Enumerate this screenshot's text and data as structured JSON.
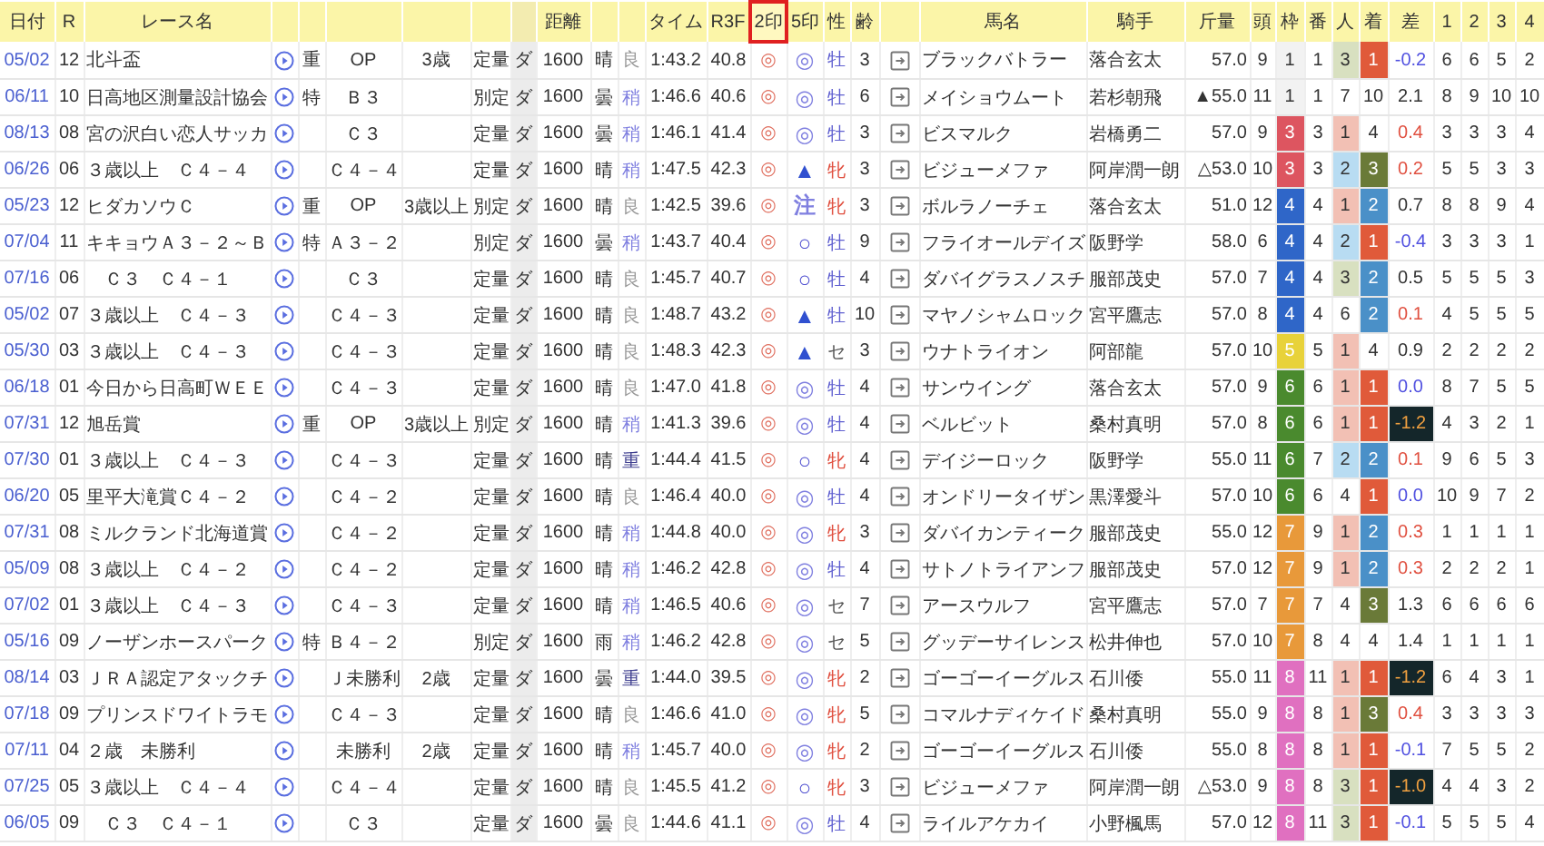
{
  "columns": [
    {
      "label": "日付",
      "selected": false
    },
    {
      "label": "R",
      "selected": false
    },
    {
      "label": "レース名",
      "selected": false
    },
    {
      "selected": false
    },
    {
      "selected": false
    },
    {
      "selected": false
    },
    {
      "selected": false
    },
    {
      "selected": false
    },
    {
      "selected": false
    },
    {
      "label": "距離",
      "selected": false
    },
    {
      "selected": false
    },
    {
      "selected": false
    },
    {
      "label": "タイム",
      "selected": false
    },
    {
      "label": "R3F",
      "selected": false
    },
    {
      "label": "2印",
      "selected": true
    },
    {
      "label": "5印",
      "selected": false
    },
    {
      "label": "性",
      "selected": false
    },
    {
      "label": "齢",
      "selected": false
    },
    {
      "selected": false
    },
    {
      "label": "馬名",
      "selected": false
    },
    {
      "label": "騎手",
      "selected": false
    },
    {
      "label": "斤量",
      "selected": false
    },
    {
      "label": "頭",
      "selected": false
    },
    {
      "label": "枠",
      "selected": false
    },
    {
      "label": "番",
      "selected": false
    },
    {
      "label": "人",
      "selected": false
    },
    {
      "label": "着",
      "selected": false
    },
    {
      "label": "差",
      "selected": false
    },
    {
      "label": "1",
      "selected": false
    },
    {
      "label": "2",
      "selected": false
    },
    {
      "label": "3",
      "selected": false
    },
    {
      "label": "4",
      "selected": false
    }
  ],
  "rows": [
    {
      "date": "05/02",
      "r": "12",
      "name": "北斗盃",
      "grade": "重",
      "class": "OP",
      "age": "3歳",
      "rule": "定量",
      "surface": "ダ",
      "distance": "1600",
      "weather": "晴",
      "going": {
        "text": "良",
        "color": "#999999"
      },
      "time": "1:43.2",
      "r3f": "40.8",
      "mark2": "◎",
      "mark5": {
        "text": "◎",
        "color": "#8080e0"
      },
      "sex": {
        "text": "牡",
        "color": "#6060d0"
      },
      "years": "3",
      "horse": "ブラックバトラー",
      "jockey": "落合玄太",
      "kinryo": "57.0",
      "heads": "9",
      "frame": {
        "text": "1",
        "color": "#f2f2f2",
        "kind": "light"
      },
      "number": "1",
      "pop": {
        "text": "3",
        "color": "#d8e0c0"
      },
      "finish": {
        "text": "1",
        "color": "#e05a3a"
      },
      "diff": {
        "text": "-0.2",
        "kind": "neg"
      },
      "corners": [
        "6",
        "6",
        "5",
        "2"
      ]
    },
    {
      "date": "06/11",
      "r": "10",
      "name": "日高地区測量設計協会",
      "grade": "特",
      "class": "Ｂ３",
      "rule": "別定",
      "surface": "ダ",
      "distance": "1600",
      "weather": "曇",
      "going": {
        "text": "稍",
        "color": "#8080e0"
      },
      "time": "1:46.6",
      "r3f": "40.6",
      "mark2": "◎",
      "mark5": {
        "text": "◎",
        "color": "#8080e0"
      },
      "sex": {
        "text": "牡",
        "color": "#6060d0"
      },
      "years": "6",
      "horse": "メイショウムート",
      "jockey": "若杉朝飛",
      "kinryo": "▲55.0",
      "heads": "11",
      "frame": {
        "text": "1",
        "color": "#f2f2f2",
        "kind": "light"
      },
      "number": "1",
      "pop": {
        "text": "7"
      },
      "finish": {
        "text": "10"
      },
      "diff": {
        "text": "2.1",
        "kind": "plain"
      },
      "corners": [
        "8",
        "9",
        "10",
        "10"
      ]
    },
    {
      "date": "08/13",
      "r": "08",
      "name": "宮の沢白い恋人サッカ",
      "class": "Ｃ３",
      "rule": "定量",
      "surface": "ダ",
      "distance": "1600",
      "weather": "曇",
      "going": {
        "text": "稍",
        "color": "#8080e0"
      },
      "time": "1:46.1",
      "r3f": "41.4",
      "mark2": "◎",
      "mark5": {
        "text": "◎",
        "color": "#8080e0"
      },
      "sex": {
        "text": "牡",
        "color": "#6060d0"
      },
      "years": "3",
      "horse": "ビスマルク",
      "jockey": "岩橋勇二",
      "kinryo": "57.0",
      "heads": "9",
      "frame": {
        "text": "3",
        "color": "#dd5560",
        "kind": "dark"
      },
      "number": "3",
      "pop": {
        "text": "1",
        "color": "#f2c0b4"
      },
      "finish": {
        "text": "4"
      },
      "diff": {
        "text": "0.4",
        "kind": "pos"
      },
      "corners": [
        "3",
        "3",
        "3",
        "4"
      ]
    },
    {
      "date": "06/26",
      "r": "06",
      "name": "３歳以上　Ｃ４－４",
      "class": "Ｃ４－４",
      "rule": "定量",
      "surface": "ダ",
      "distance": "1600",
      "weather": "晴",
      "going": {
        "text": "稍",
        "color": "#8080e0"
      },
      "time": "1:47.5",
      "r3f": "42.3",
      "mark2": "◎",
      "mark5": {
        "text": "▲",
        "color": "#3050d0"
      },
      "sex": {
        "text": "牝",
        "color": "#e05040"
      },
      "years": "3",
      "horse": "ビジューメファ",
      "jockey": "阿岸潤一朗",
      "kinryo": "△53.0",
      "heads": "10",
      "frame": {
        "text": "3",
        "color": "#dd5560",
        "kind": "dark"
      },
      "number": "3",
      "pop": {
        "text": "2",
        "color": "#b8dcf2"
      },
      "finish": {
        "text": "3",
        "color": "#6a7a38"
      },
      "diff": {
        "text": "0.2",
        "kind": "pos"
      },
      "corners": [
        "5",
        "5",
        "3",
        "3"
      ]
    },
    {
      "date": "05/23",
      "r": "12",
      "name": "ヒダカソウＣ",
      "grade": "重",
      "class": "OP",
      "age": "3歳以上",
      "rule": "別定",
      "surface": "ダ",
      "distance": "1600",
      "weather": "晴",
      "going": {
        "text": "良",
        "color": "#999999"
      },
      "time": "1:42.5",
      "r3f": "39.6",
      "mark2": "◎",
      "mark5": {
        "text": "注",
        "color": "#8080e0"
      },
      "sex": {
        "text": "牝",
        "color": "#e05040"
      },
      "years": "3",
      "horse": "ボルラノーチェ",
      "jockey": "落合玄太",
      "kinryo": "51.0",
      "heads": "12",
      "frame": {
        "text": "4",
        "color": "#2f66c8",
        "kind": "dark"
      },
      "number": "4",
      "pop": {
        "text": "1",
        "color": "#f2c0b4"
      },
      "finish": {
        "text": "2",
        "color": "#4a90c8"
      },
      "diff": {
        "text": "0.7",
        "kind": "plain"
      },
      "corners": [
        "8",
        "8",
        "9",
        "4"
      ]
    },
    {
      "date": "07/04",
      "r": "11",
      "name": "キキョウＡ３－２～Ｂ",
      "grade": "特",
      "class": "Ａ３－２",
      "rule": "別定",
      "surface": "ダ",
      "distance": "1600",
      "weather": "曇",
      "going": {
        "text": "稍",
        "color": "#8080e0"
      },
      "time": "1:43.7",
      "r3f": "40.4",
      "mark2": "◎",
      "mark5": {
        "text": "○",
        "color": "#5050d0"
      },
      "sex": {
        "text": "牡",
        "color": "#6060d0"
      },
      "years": "9",
      "horse": "フライオールデイズ",
      "jockey": "阪野学",
      "kinryo": "58.0",
      "heads": "6",
      "frame": {
        "text": "4",
        "color": "#2f66c8",
        "kind": "dark"
      },
      "number": "4",
      "pop": {
        "text": "2",
        "color": "#b8dcf2"
      },
      "finish": {
        "text": "1",
        "color": "#e05a3a"
      },
      "diff": {
        "text": "-0.4",
        "kind": "neg"
      },
      "corners": [
        "3",
        "3",
        "3",
        "1"
      ]
    },
    {
      "date": "07/16",
      "r": "06",
      "name": "　Ｃ３　Ｃ４－１",
      "class": "Ｃ３",
      "rule": "定量",
      "surface": "ダ",
      "distance": "1600",
      "weather": "晴",
      "going": {
        "text": "良",
        "color": "#999999"
      },
      "time": "1:45.7",
      "r3f": "40.7",
      "mark2": "◎",
      "mark5": {
        "text": "○",
        "color": "#5050d0"
      },
      "sex": {
        "text": "牡",
        "color": "#6060d0"
      },
      "years": "4",
      "horse": "ダバイグラスノスチ",
      "jockey": "服部茂史",
      "kinryo": "57.0",
      "heads": "7",
      "frame": {
        "text": "4",
        "color": "#2f66c8",
        "kind": "dark"
      },
      "number": "4",
      "pop": {
        "text": "3",
        "color": "#d8e0c0"
      },
      "finish": {
        "text": "2",
        "color": "#4a90c8"
      },
      "diff": {
        "text": "0.5",
        "kind": "plain"
      },
      "corners": [
        "5",
        "5",
        "5",
        "3"
      ]
    },
    {
      "date": "05/02",
      "r": "07",
      "name": "３歳以上　Ｃ４－３",
      "class": "Ｃ４－３",
      "rule": "定量",
      "surface": "ダ",
      "distance": "1600",
      "weather": "晴",
      "going": {
        "text": "良",
        "color": "#999999"
      },
      "time": "1:48.7",
      "r3f": "43.2",
      "mark2": "◎",
      "mark5": {
        "text": "▲",
        "color": "#3050d0"
      },
      "sex": {
        "text": "牡",
        "color": "#6060d0"
      },
      "years": "10",
      "horse": "マヤノシャムロック",
      "jockey": "宮平鷹志",
      "kinryo": "57.0",
      "heads": "8",
      "frame": {
        "text": "4",
        "color": "#2f66c8",
        "kind": "dark"
      },
      "number": "4",
      "pop": {
        "text": "6"
      },
      "finish": {
        "text": "2",
        "color": "#4a90c8"
      },
      "diff": {
        "text": "0.1",
        "kind": "pos"
      },
      "corners": [
        "4",
        "5",
        "5",
        "5"
      ]
    },
    {
      "date": "05/30",
      "r": "03",
      "name": "３歳以上　Ｃ４－３",
      "class": "Ｃ４－３",
      "rule": "定量",
      "surface": "ダ",
      "distance": "1600",
      "weather": "晴",
      "going": {
        "text": "良",
        "color": "#999999"
      },
      "time": "1:48.3",
      "r3f": "42.3",
      "mark2": "◎",
      "mark5": {
        "text": "▲",
        "color": "#3050d0"
      },
      "sex": {
        "text": "セ",
        "color": "#555555"
      },
      "years": "3",
      "horse": "ウナトライオン",
      "jockey": "阿部龍",
      "kinryo": "57.0",
      "heads": "10",
      "frame": {
        "text": "5",
        "color": "#e8d23a",
        "kind": "dark"
      },
      "number": "5",
      "pop": {
        "text": "1",
        "color": "#f2c0b4"
      },
      "finish": {
        "text": "4"
      },
      "diff": {
        "text": "0.9",
        "kind": "plain"
      },
      "corners": [
        "2",
        "2",
        "2",
        "2"
      ]
    },
    {
      "date": "06/18",
      "r": "01",
      "name": "今日から日高町ＷＥＥ",
      "class": "Ｃ４－３",
      "rule": "定量",
      "surface": "ダ",
      "distance": "1600",
      "weather": "晴",
      "going": {
        "text": "良",
        "color": "#999999"
      },
      "time": "1:47.0",
      "r3f": "41.8",
      "mark2": "◎",
      "mark5": {
        "text": "◎",
        "color": "#8080e0"
      },
      "sex": {
        "text": "牡",
        "color": "#6060d0"
      },
      "years": "4",
      "horse": "サンウイング",
      "jockey": "落合玄太",
      "kinryo": "57.0",
      "heads": "9",
      "frame": {
        "text": "6",
        "color": "#4a8a2e",
        "kind": "dark"
      },
      "number": "6",
      "pop": {
        "text": "1",
        "color": "#f2c0b4"
      },
      "finish": {
        "text": "1",
        "color": "#e05a3a"
      },
      "diff": {
        "text": "0.0",
        "kind": "neg"
      },
      "corners": [
        "8",
        "7",
        "5",
        "5"
      ]
    },
    {
      "date": "07/31",
      "r": "12",
      "name": "旭岳賞",
      "grade": "重",
      "class": "OP",
      "age": "3歳以上",
      "rule": "別定",
      "surface": "ダ",
      "distance": "1600",
      "weather": "晴",
      "going": {
        "text": "稍",
        "color": "#8080e0"
      },
      "time": "1:41.3",
      "r3f": "39.6",
      "mark2": "◎",
      "mark5": {
        "text": "◎",
        "color": "#8080e0"
      },
      "sex": {
        "text": "牡",
        "color": "#6060d0"
      },
      "years": "4",
      "horse": "ベルビット",
      "jockey": "桑村真明",
      "kinryo": "57.0",
      "heads": "8",
      "frame": {
        "text": "6",
        "color": "#4a8a2e",
        "kind": "dark"
      },
      "number": "6",
      "pop": {
        "text": "1",
        "color": "#f2c0b4"
      },
      "finish": {
        "text": "1",
        "color": "#e05a3a"
      },
      "diff": {
        "text": "-1.2",
        "kind": "big"
      },
      "corners": [
        "4",
        "3",
        "2",
        "1"
      ]
    },
    {
      "date": "07/30",
      "r": "01",
      "name": "３歳以上　Ｃ４－３",
      "class": "Ｃ４－３",
      "rule": "定量",
      "surface": "ダ",
      "distance": "1600",
      "weather": "晴",
      "going": {
        "text": "重",
        "color": "#404090"
      },
      "time": "1:44.4",
      "r3f": "41.5",
      "mark2": "◎",
      "mark5": {
        "text": "○",
        "color": "#5050d0"
      },
      "sex": {
        "text": "牝",
        "color": "#e05040"
      },
      "years": "4",
      "horse": "デイジーロック",
      "jockey": "阪野学",
      "kinryo": "55.0",
      "heads": "11",
      "frame": {
        "text": "6",
        "color": "#4a8a2e",
        "kind": "dark"
      },
      "number": "7",
      "pop": {
        "text": "2",
        "color": "#b8dcf2"
      },
      "finish": {
        "text": "2",
        "color": "#4a90c8"
      },
      "diff": {
        "text": "0.1",
        "kind": "pos"
      },
      "corners": [
        "9",
        "6",
        "5",
        "3"
      ]
    },
    {
      "date": "06/20",
      "r": "05",
      "name": "里平大滝賞Ｃ４－２",
      "class": "Ｃ４－２",
      "rule": "定量",
      "surface": "ダ",
      "distance": "1600",
      "weather": "晴",
      "going": {
        "text": "良",
        "color": "#999999"
      },
      "time": "1:46.4",
      "r3f": "40.0",
      "mark2": "◎",
      "mark5": {
        "text": "◎",
        "color": "#8080e0"
      },
      "sex": {
        "text": "牡",
        "color": "#6060d0"
      },
      "years": "4",
      "horse": "オンドリータイザン",
      "jockey": "黒澤愛斗",
      "kinryo": "57.0",
      "heads": "10",
      "frame": {
        "text": "6",
        "color": "#4a8a2e",
        "kind": "dark"
      },
      "number": "6",
      "pop": {
        "text": "4"
      },
      "finish": {
        "text": "1",
        "color": "#e05a3a"
      },
      "diff": {
        "text": "0.0",
        "kind": "neg"
      },
      "corners": [
        "10",
        "9",
        "7",
        "2"
      ]
    },
    {
      "date": "07/31",
      "r": "08",
      "name": "ミルクランド北海道賞",
      "class": "Ｃ４－２",
      "rule": "定量",
      "surface": "ダ",
      "distance": "1600",
      "weather": "晴",
      "going": {
        "text": "稍",
        "color": "#8080e0"
      },
      "time": "1:44.8",
      "r3f": "40.0",
      "mark2": "◎",
      "mark5": {
        "text": "◎",
        "color": "#8080e0"
      },
      "sex": {
        "text": "牝",
        "color": "#e05040"
      },
      "years": "3",
      "horse": "ダバイカンティーク",
      "jockey": "服部茂史",
      "kinryo": "55.0",
      "heads": "12",
      "frame": {
        "text": "7",
        "color": "#e8993a",
        "kind": "dark"
      },
      "number": "9",
      "pop": {
        "text": "1",
        "color": "#f2c0b4"
      },
      "finish": {
        "text": "2",
        "color": "#4a90c8"
      },
      "diff": {
        "text": "0.3",
        "kind": "pos"
      },
      "corners": [
        "1",
        "1",
        "1",
        "1"
      ]
    },
    {
      "date": "05/09",
      "r": "08",
      "name": "３歳以上　Ｃ４－２",
      "class": "Ｃ４－２",
      "rule": "定量",
      "surface": "ダ",
      "distance": "1600",
      "weather": "晴",
      "going": {
        "text": "稍",
        "color": "#8080e0"
      },
      "time": "1:46.2",
      "r3f": "42.8",
      "mark2": "◎",
      "mark5": {
        "text": "◎",
        "color": "#8080e0"
      },
      "sex": {
        "text": "牡",
        "color": "#6060d0"
      },
      "years": "4",
      "horse": "サトノトライアンフ",
      "jockey": "服部茂史",
      "kinryo": "57.0",
      "heads": "12",
      "frame": {
        "text": "7",
        "color": "#e8993a",
        "kind": "dark"
      },
      "number": "9",
      "pop": {
        "text": "1",
        "color": "#f2c0b4"
      },
      "finish": {
        "text": "2",
        "color": "#4a90c8"
      },
      "diff": {
        "text": "0.3",
        "kind": "pos"
      },
      "corners": [
        "2",
        "2",
        "2",
        "1"
      ]
    },
    {
      "date": "07/02",
      "r": "01",
      "name": "３歳以上　Ｃ４－３",
      "class": "Ｃ４－３",
      "rule": "定量",
      "surface": "ダ",
      "distance": "1600",
      "weather": "晴",
      "going": {
        "text": "稍",
        "color": "#8080e0"
      },
      "time": "1:46.5",
      "r3f": "40.6",
      "mark2": "◎",
      "mark5": {
        "text": "◎",
        "color": "#8080e0"
      },
      "sex": {
        "text": "セ",
        "color": "#555555"
      },
      "years": "7",
      "horse": "アースウルフ",
      "jockey": "宮平鷹志",
      "kinryo": "57.0",
      "heads": "7",
      "frame": {
        "text": "7",
        "color": "#e8993a",
        "kind": "dark"
      },
      "number": "7",
      "pop": {
        "text": "4"
      },
      "finish": {
        "text": "3",
        "color": "#6a7a38"
      },
      "diff": {
        "text": "1.3",
        "kind": "plain"
      },
      "corners": [
        "6",
        "6",
        "6",
        "6"
      ]
    },
    {
      "date": "05/16",
      "r": "09",
      "name": "ノーザンホースパーク",
      "grade": "特",
      "class": "Ｂ４－２",
      "rule": "別定",
      "surface": "ダ",
      "distance": "1600",
      "weather": "雨",
      "going": {
        "text": "稍",
        "color": "#8080e0"
      },
      "time": "1:46.2",
      "r3f": "42.8",
      "mark2": "◎",
      "mark5": {
        "text": "◎",
        "color": "#8080e0"
      },
      "sex": {
        "text": "セ",
        "color": "#555555"
      },
      "years": "5",
      "horse": "グッデーサイレンス",
      "jockey": "松井伸也",
      "kinryo": "57.0",
      "heads": "10",
      "frame": {
        "text": "7",
        "color": "#e8993a",
        "kind": "dark"
      },
      "number": "8",
      "pop": {
        "text": "4"
      },
      "finish": {
        "text": "4"
      },
      "diff": {
        "text": "1.4",
        "kind": "plain"
      },
      "corners": [
        "1",
        "1",
        "1",
        "1"
      ]
    },
    {
      "date": "08/14",
      "r": "03",
      "name": "ＪＲＡ認定アタックチ",
      "class": "Ｊ未勝利",
      "age": "2歳",
      "rule": "定量",
      "surface": "ダ",
      "distance": "1600",
      "weather": "曇",
      "going": {
        "text": "重",
        "color": "#404090"
      },
      "time": "1:44.0",
      "r3f": "39.5",
      "mark2": "◎",
      "mark5": {
        "text": "◎",
        "color": "#8080e0"
      },
      "sex": {
        "text": "牝",
        "color": "#e05040"
      },
      "years": "2",
      "horse": "ゴーゴーイーグルス",
      "jockey": "石川倭",
      "kinryo": "55.0",
      "heads": "11",
      "frame": {
        "text": "8",
        "color": "#e070c0",
        "kind": "dark"
      },
      "number": "11",
      "pop": {
        "text": "1",
        "color": "#f2c0b4"
      },
      "finish": {
        "text": "1",
        "color": "#e05a3a"
      },
      "diff": {
        "text": "-1.2",
        "kind": "big"
      },
      "corners": [
        "6",
        "4",
        "3",
        "1"
      ]
    },
    {
      "date": "07/18",
      "r": "09",
      "name": "プリンスドワイトラモ",
      "class": "Ｃ４－３",
      "rule": "定量",
      "surface": "ダ",
      "distance": "1600",
      "weather": "晴",
      "going": {
        "text": "良",
        "color": "#999999"
      },
      "time": "1:46.6",
      "r3f": "41.0",
      "mark2": "◎",
      "mark5": {
        "text": "◎",
        "color": "#8080e0"
      },
      "sex": {
        "text": "牝",
        "color": "#e05040"
      },
      "years": "5",
      "horse": "コマルナディケイド",
      "jockey": "桑村真明",
      "kinryo": "55.0",
      "heads": "9",
      "frame": {
        "text": "8",
        "color": "#e070c0",
        "kind": "dark"
      },
      "number": "8",
      "pop": {
        "text": "1",
        "color": "#f2c0b4"
      },
      "finish": {
        "text": "3",
        "color": "#6a7a38"
      },
      "diff": {
        "text": "0.4",
        "kind": "pos"
      },
      "corners": [
        "3",
        "3",
        "3",
        "3"
      ]
    },
    {
      "date": "07/11",
      "r": "04",
      "name": "２歳　未勝利",
      "class": "未勝利",
      "age": "2歳",
      "rule": "定量",
      "surface": "ダ",
      "distance": "1600",
      "weather": "晴",
      "going": {
        "text": "稍",
        "color": "#8080e0"
      },
      "time": "1:45.7",
      "r3f": "40.0",
      "mark2": "◎",
      "mark5": {
        "text": "◎",
        "color": "#8080e0"
      },
      "sex": {
        "text": "牝",
        "color": "#e05040"
      },
      "years": "2",
      "horse": "ゴーゴーイーグルス",
      "jockey": "石川倭",
      "kinryo": "55.0",
      "heads": "8",
      "frame": {
        "text": "8",
        "color": "#e070c0",
        "kind": "dark"
      },
      "number": "8",
      "pop": {
        "text": "1",
        "color": "#f2c0b4"
      },
      "finish": {
        "text": "1",
        "color": "#e05a3a"
      },
      "diff": {
        "text": "-0.1",
        "kind": "neg"
      },
      "corners": [
        "7",
        "5",
        "5",
        "2"
      ]
    },
    {
      "date": "07/25",
      "r": "05",
      "name": "３歳以上　Ｃ４－４",
      "class": "Ｃ４－４",
      "rule": "定量",
      "surface": "ダ",
      "distance": "1600",
      "weather": "晴",
      "going": {
        "text": "良",
        "color": "#999999"
      },
      "time": "1:45.5",
      "r3f": "41.2",
      "mark2": "◎",
      "mark5": {
        "text": "○",
        "color": "#5050d0"
      },
      "sex": {
        "text": "牝",
        "color": "#e05040"
      },
      "years": "3",
      "horse": "ビジューメファ",
      "jockey": "阿岸潤一朗",
      "kinryo": "△53.0",
      "heads": "9",
      "frame": {
        "text": "8",
        "color": "#e070c0",
        "kind": "dark"
      },
      "number": "8",
      "pop": {
        "text": "3",
        "color": "#d8e0c0"
      },
      "finish": {
        "text": "1",
        "color": "#e05a3a"
      },
      "diff": {
        "text": "-1.0",
        "kind": "big"
      },
      "corners": [
        "4",
        "4",
        "3",
        "2"
      ]
    },
    {
      "date": "06/05",
      "r": "09",
      "name": "　Ｃ３　Ｃ４－１",
      "class": "Ｃ３",
      "rule": "定量",
      "surface": "ダ",
      "distance": "1600",
      "weather": "曇",
      "going": {
        "text": "良",
        "color": "#999999"
      },
      "time": "1:44.6",
      "r3f": "41.1",
      "mark2": "◎",
      "mark5": {
        "text": "◎",
        "color": "#8080e0"
      },
      "sex": {
        "text": "牡",
        "color": "#6060d0"
      },
      "years": "4",
      "horse": "ライルアケカイ",
      "jockey": "小野楓馬",
      "kinryo": "57.0",
      "heads": "12",
      "frame": {
        "text": "8",
        "color": "#e070c0",
        "kind": "dark"
      },
      "number": "11",
      "pop": {
        "text": "3",
        "color": "#d8e0c0"
      },
      "finish": {
        "text": "1",
        "color": "#e05a3a"
      },
      "diff": {
        "text": "-0.1",
        "kind": "neg"
      },
      "corners": [
        "5",
        "5",
        "5",
        "4"
      ]
    }
  ]
}
